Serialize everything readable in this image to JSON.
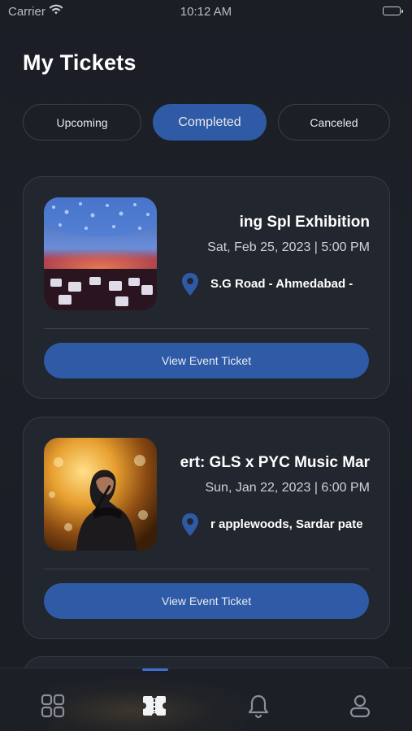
{
  "status_bar": {
    "carrier": "Carrier",
    "time": "10:12 AM",
    "wifi_icon": "wifi-icon",
    "battery_icon": "battery-icon"
  },
  "header": {
    "title": "My Tickets"
  },
  "tabs": [
    {
      "label": "Upcoming",
      "selected": false
    },
    {
      "label": "Completed",
      "selected": true
    },
    {
      "label": "Canceled",
      "selected": false
    }
  ],
  "tickets": [
    {
      "title": "ing Spl Exhibition",
      "date": "Sat, Feb 25, 2023 | 5:00 PM",
      "location": "  - S.G Road - Ahmedabad",
      "location_icon": "location-pin-icon",
      "image": "event-hall-image",
      "button_label": "View Event Ticket"
    },
    {
      "title": "ert: GLS x PYC Music Mar",
      "date": "Sun, Jan 22, 2023 | 6:00 PM",
      "location": "‌r applewoods, Sardar pate",
      "location_icon": "location-pin-icon",
      "image": "singer-concert-image",
      "button_label": "View Event Ticket"
    }
  ],
  "bottom_nav": [
    {
      "name": "home",
      "icon": "grid-icon",
      "active": false
    },
    {
      "name": "tickets",
      "icon": "ticket-icon",
      "active": true
    },
    {
      "name": "notifications",
      "icon": "bell-icon",
      "active": false
    },
    {
      "name": "profile",
      "icon": "user-icon",
      "active": false
    }
  ],
  "colors": {
    "background": "#1b1e25",
    "card": "#22262e",
    "accent": "#2e5aa6",
    "indicator": "#3d6fd0"
  }
}
